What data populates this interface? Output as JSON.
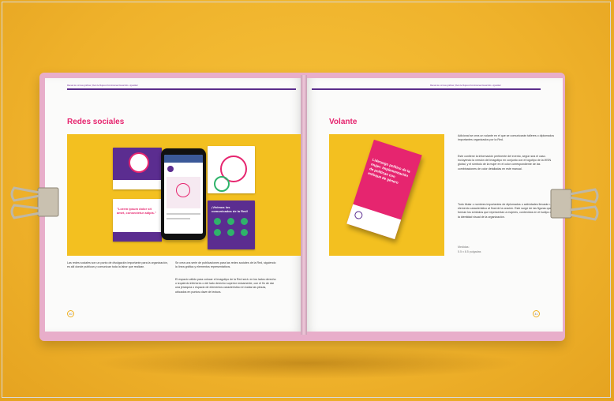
{
  "left_page": {
    "header": "Manual de normas gráficas | Red de Mujeres Dominicanas Desarrollo e Igualdad",
    "title": "Redes sociales",
    "col1": "Las redes sociales son un punto de divulgación importante para la organización, es allí donde publican y comunican toda la labor que realizan.",
    "col2a": "Se crea una serie de publicaciones para las redes sociales de la Red, siguiendo la línea gráfica y elementos representativos.",
    "col2b": "El espacio válido para colocar el imagotipo de la Red será: en los lados derecho o izquierdo inferiores o del lado derecho superior únicamente, con el fin de dar una jerarquía o espacio de elementos característico en todas las piezas, ubicados en puntos clave de lectura.",
    "page_number": "40",
    "card_texts": [
      "\"Lorem ipsum dolor sit amet, consectetur adipis.\"",
      "¡Vivimos los comunicados de la Red!"
    ]
  },
  "right_page": {
    "header": "Manual de normas gráficas | Red de Mujeres Dominicanas Desarrollo e Igualdad",
    "title": "Volante",
    "p1": "Adicional se crea un volante en el que se comunicarán talleres o diplomados importantes organizados por la Red.",
    "p2": "Este contiene la información pertinente del evento, según sea el caso. Incluyendo la versión del imagotipo en conjunto con el logotipo de la WSN global, y el símbolo de la mujer en el color correspondiente de las combinaciones de color detalladas en este manual.",
    "p3": "Todo titular o nombres importantes de diplomados o actividades llevarán un elemento característico al final de la oración. Este surge de las figuras que forman los símbolos que representan a mujeres, contenidos en el isotipo de la identidad visual de la organización.",
    "measures_label": "Medidas:",
    "measures_value": "5.5 x 8.5 pulgadas",
    "flyer_title": "Liderazgo político de la mujer: Implementación de políticas con enfoque de género",
    "page_number": "41"
  },
  "colors": {
    "background": "#f1b62f",
    "cover": "#e8aeca",
    "accent_pink": "#e6256f",
    "accent_purple": "#5a2d8c",
    "photo_yellow": "#f3c020"
  }
}
